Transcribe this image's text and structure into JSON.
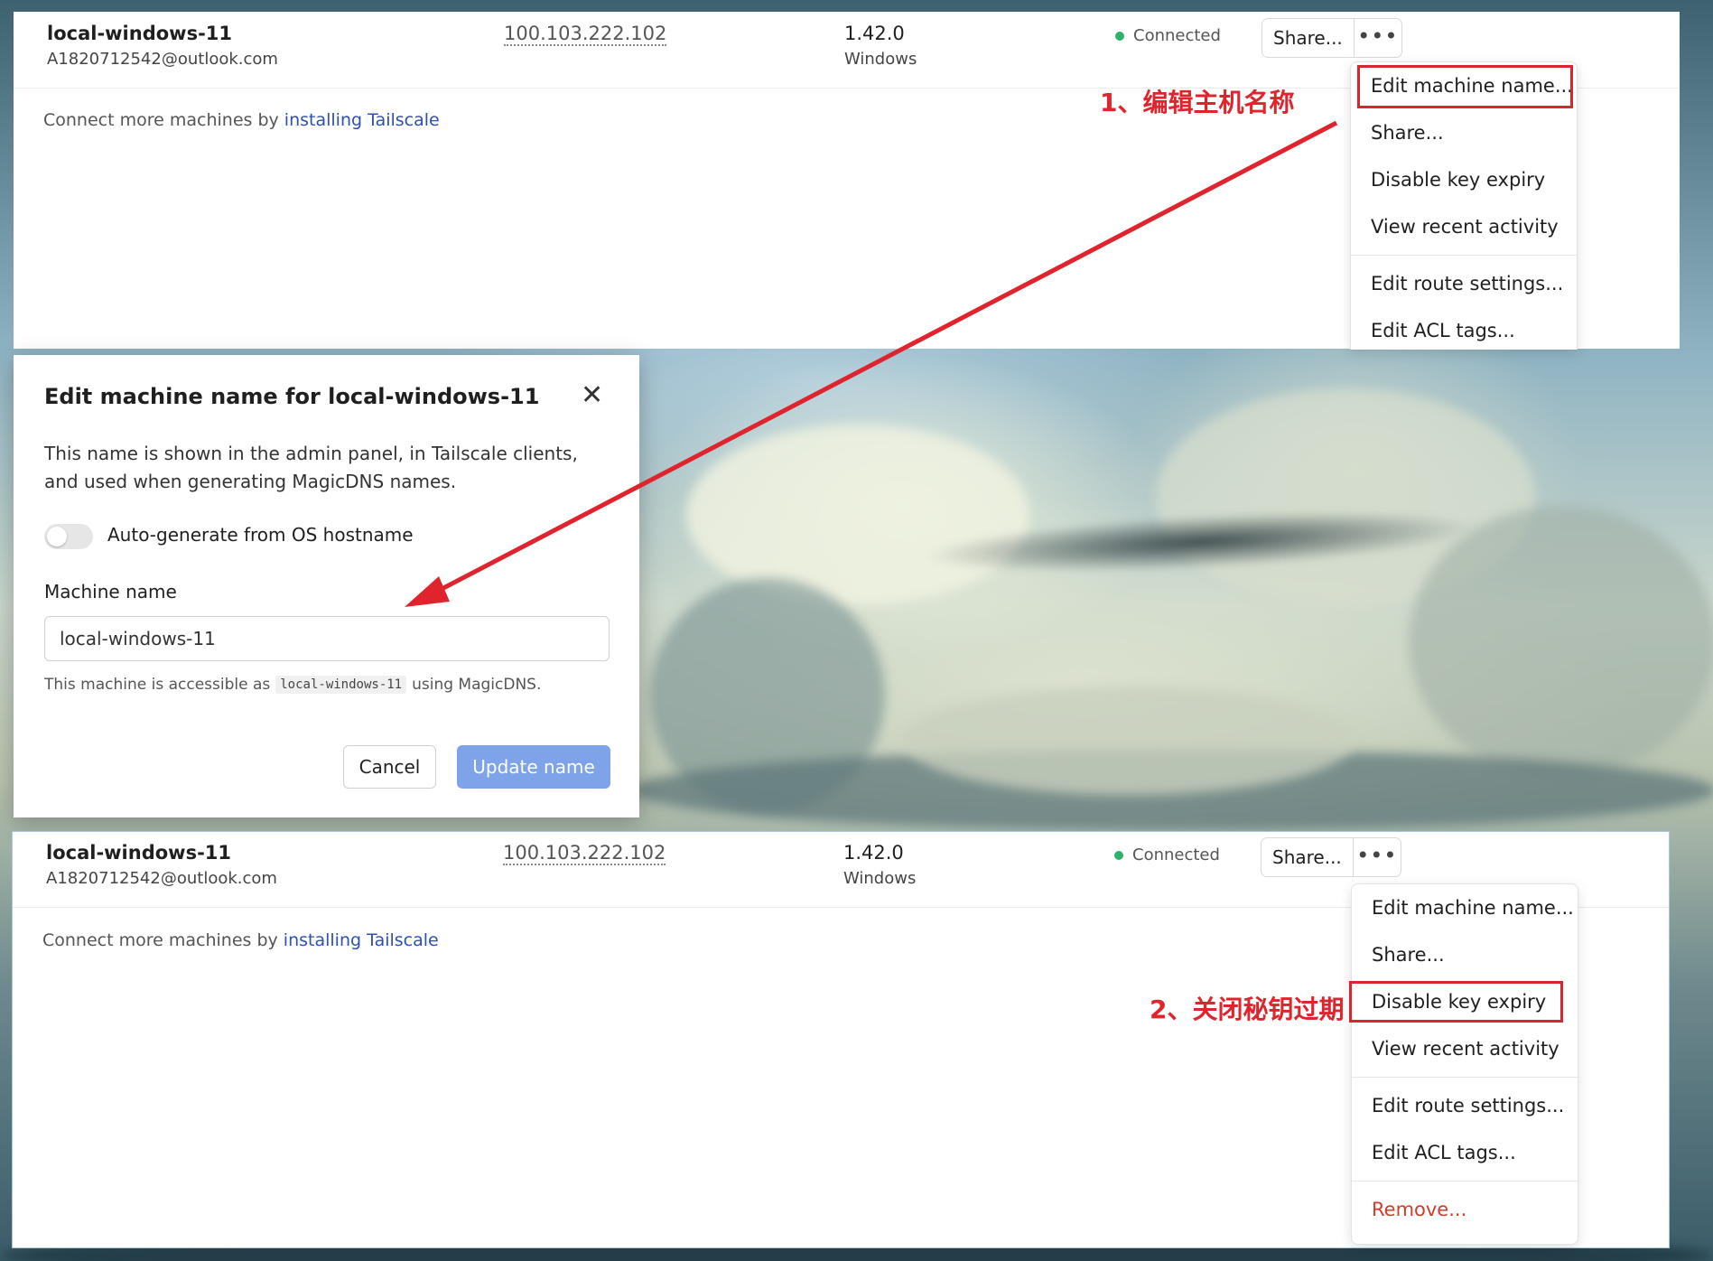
{
  "top_panel": {
    "machine": {
      "name": "local-windows-11",
      "owner": "A1820712542@outlook.com",
      "ip": "100.103.222.102",
      "version": "1.42.0",
      "os": "Windows",
      "status": "Connected",
      "share_label": "Share...",
      "more_label": "•••"
    },
    "connect_more": {
      "prefix": "Connect more machines by ",
      "link1": "installing",
      "link2": "Tailscale"
    },
    "menu": [
      "Edit machine name...",
      "Share...",
      "Disable key expiry",
      "View recent activity",
      "Edit route settings...",
      "Edit ACL tags..."
    ]
  },
  "dialog": {
    "title": "Edit machine name for local-windows-11",
    "close": "✕",
    "description": "This name is shown in the admin panel, in Tailscale clients, and used when generating MagicDNS names.",
    "toggle_label": "Auto-generate from OS hostname",
    "toggle_on": false,
    "field_label": "Machine name",
    "field_value": "local-windows-11",
    "hint_prefix": "This machine is accessible as",
    "hint_code": "local-windows-11",
    "hint_suffix": "using MagicDNS.",
    "cancel_label": "Cancel",
    "update_label": "Update name"
  },
  "bottom_panel": {
    "machine": {
      "name": "local-windows-11",
      "owner": "A1820712542@outlook.com",
      "ip": "100.103.222.102",
      "version": "1.42.0",
      "os": "Windows",
      "status": "Connected",
      "share_label": "Share...",
      "more_label": "•••"
    },
    "connect_more": {
      "prefix": "Connect more machines by ",
      "link1": "installing",
      "link2": "Tailscale"
    },
    "menu": [
      "Edit machine name...",
      "Share...",
      "Disable key expiry",
      "View recent activity",
      "Edit route settings...",
      "Edit ACL tags...",
      "Remove..."
    ]
  },
  "annotations": {
    "step1": "1、编辑主机名称",
    "step2": "2、关闭秘钥过期",
    "color": "#e0242d"
  },
  "colors": {
    "status_green": "#2eb26b",
    "link_blue": "#2e4fb3",
    "primary_button": "#7fa3e8",
    "danger_red": "#d23c2b"
  }
}
